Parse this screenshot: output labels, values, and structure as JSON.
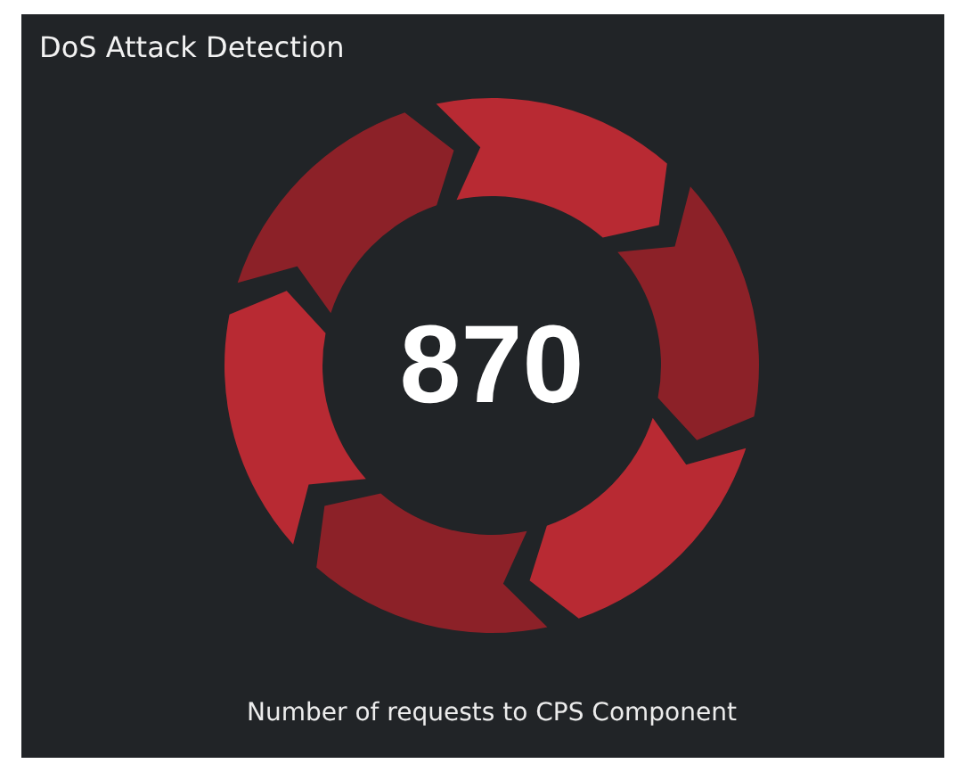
{
  "panel": {
    "title": "DoS Attack Detection",
    "value": "870",
    "caption": "Number of requests to CPS Component"
  }
}
